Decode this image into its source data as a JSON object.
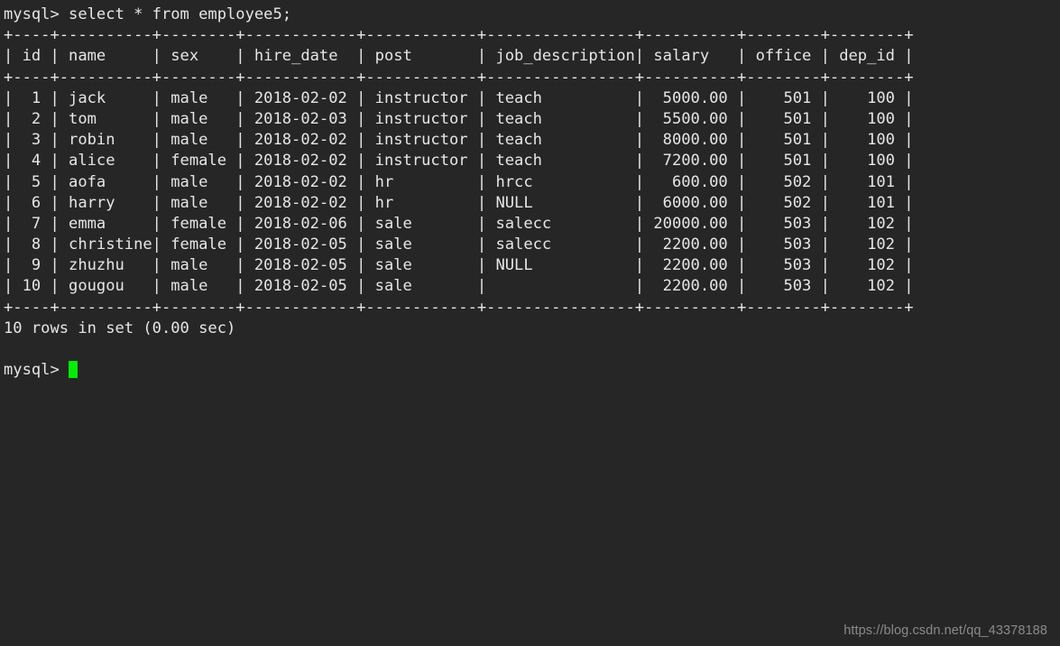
{
  "terminal": {
    "prompt": "mysql> ",
    "command": "select * from employee5;",
    "result_status": "10 rows in set (0.00 sec)",
    "final_prompt": "mysql> ",
    "cursor_color": "#00ee00",
    "background_color": "#262626",
    "text_color": "#e6e6e6"
  },
  "table": {
    "name": "employee5",
    "columns": [
      {
        "name": "id",
        "width": 4,
        "align": "right"
      },
      {
        "name": "name",
        "width": 10,
        "align": "left"
      },
      {
        "name": "sex",
        "width": 8,
        "align": "left"
      },
      {
        "name": "hire_date",
        "width": 12,
        "align": "left"
      },
      {
        "name": "post",
        "width": 12,
        "align": "left"
      },
      {
        "name": "job_description",
        "width": 16,
        "align": "left"
      },
      {
        "name": "salary",
        "width": 10,
        "align": "right"
      },
      {
        "name": "office",
        "width": 8,
        "align": "right"
      },
      {
        "name": "dep_id",
        "width": 8,
        "align": "right"
      }
    ],
    "rows": [
      {
        "id": "1",
        "name": "jack",
        "sex": "male",
        "hire_date": "2018-02-02",
        "post": "instructor",
        "job_description": "teach",
        "salary": "5000.00",
        "office": "501",
        "dep_id": "100"
      },
      {
        "id": "2",
        "name": "tom",
        "sex": "male",
        "hire_date": "2018-02-03",
        "post": "instructor",
        "job_description": "teach",
        "salary": "5500.00",
        "office": "501",
        "dep_id": "100"
      },
      {
        "id": "3",
        "name": "robin",
        "sex": "male",
        "hire_date": "2018-02-02",
        "post": "instructor",
        "job_description": "teach",
        "salary": "8000.00",
        "office": "501",
        "dep_id": "100"
      },
      {
        "id": "4",
        "name": "alice",
        "sex": "female",
        "hire_date": "2018-02-02",
        "post": "instructor",
        "job_description": "teach",
        "salary": "7200.00",
        "office": "501",
        "dep_id": "100"
      },
      {
        "id": "5",
        "name": "aofa",
        "sex": "male",
        "hire_date": "2018-02-02",
        "post": "hr",
        "job_description": "hrcc",
        "salary": "600.00",
        "office": "502",
        "dep_id": "101"
      },
      {
        "id": "6",
        "name": "harry",
        "sex": "male",
        "hire_date": "2018-02-02",
        "post": "hr",
        "job_description": "NULL",
        "salary": "6000.00",
        "office": "502",
        "dep_id": "101"
      },
      {
        "id": "7",
        "name": "emma",
        "sex": "female",
        "hire_date": "2018-02-06",
        "post": "sale",
        "job_description": "salecc",
        "salary": "20000.00",
        "office": "503",
        "dep_id": "102"
      },
      {
        "id": "8",
        "name": "christine",
        "sex": "female",
        "hire_date": "2018-02-05",
        "post": "sale",
        "job_description": "salecc",
        "salary": "2200.00",
        "office": "503",
        "dep_id": "102"
      },
      {
        "id": "9",
        "name": "zhuzhu",
        "sex": "male",
        "hire_date": "2018-02-05",
        "post": "sale",
        "job_description": "NULL",
        "salary": "2200.00",
        "office": "503",
        "dep_id": "102"
      },
      {
        "id": "10",
        "name": "gougou",
        "sex": "male",
        "hire_date": "2018-02-05",
        "post": "sale",
        "job_description": "",
        "salary": "2200.00",
        "office": "503",
        "dep_id": "102"
      }
    ],
    "row_count_label": "10 rows in set (0.00 sec)"
  },
  "watermark": {
    "text": "https://blog.csdn.net/qq_43378188"
  }
}
